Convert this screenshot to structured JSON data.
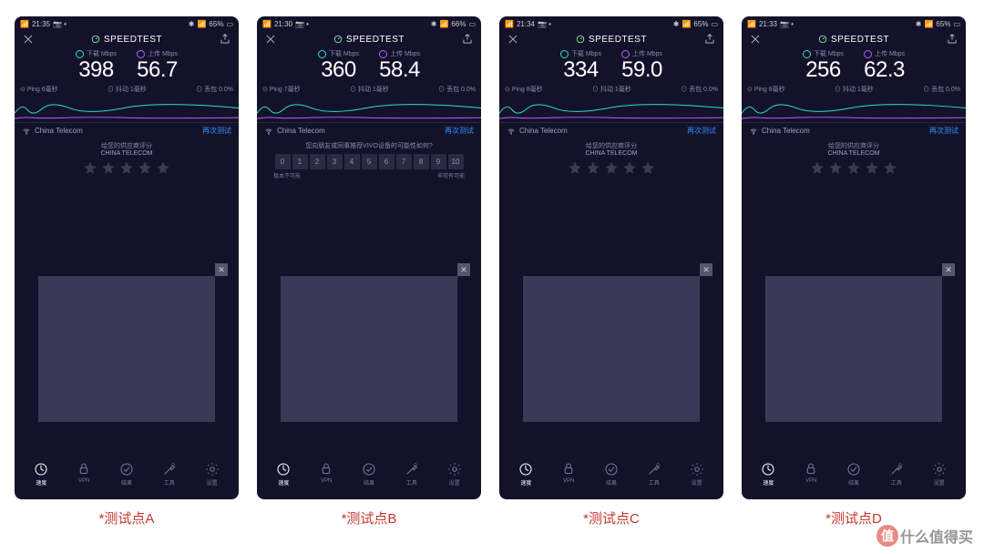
{
  "app_title": "SPEEDTEST",
  "download_label": "下载 Mbps",
  "upload_label": "上传 Mbps",
  "ping_label": "Ping",
  "jitter_label": "抖动",
  "loss_label": "丢包",
  "retest": "再次测试",
  "provider_q1": "给您的供应商评分",
  "provider_q2": "CHINA TELECOM",
  "nav": [
    "速度",
    "VPN",
    "结果",
    "工具",
    "设置"
  ],
  "nps_q": "您向朋友或同事推荐VIVO设备的可能性如何?",
  "nps_low": "极本不可能",
  "nps_high": "非常有可能",
  "watermark": "什么值得买",
  "panels": [
    {
      "time": "21:35",
      "battery": "65%",
      "download": "398",
      "upload": "56.7",
      "ping": "6毫秒",
      "jitter": "1毫秒",
      "loss": "0.0%",
      "isp": "China Telecom",
      "caption": "*测试点A",
      "rating_type": "stars"
    },
    {
      "time": "21:30",
      "battery": "66%",
      "download": "360",
      "upload": "58.4",
      "ping": "7毫秒",
      "jitter": "1毫秒",
      "loss": "0.0%",
      "isp": "China Telecom",
      "caption": "*测试点B",
      "rating_type": "nps"
    },
    {
      "time": "21:34",
      "battery": "65%",
      "download": "334",
      "upload": "59.0",
      "ping": "8毫秒",
      "jitter": "1毫秒",
      "loss": "0.0%",
      "isp": "China Telecom",
      "caption": "*测试点C",
      "rating_type": "stars"
    },
    {
      "time": "21:33",
      "battery": "65%",
      "download": "256",
      "upload": "62.3",
      "ping": "8毫秒",
      "jitter": "1毫秒",
      "loss": "0.0%",
      "isp": "China Telecom",
      "caption": "*测试点D",
      "rating_type": "stars"
    }
  ]
}
